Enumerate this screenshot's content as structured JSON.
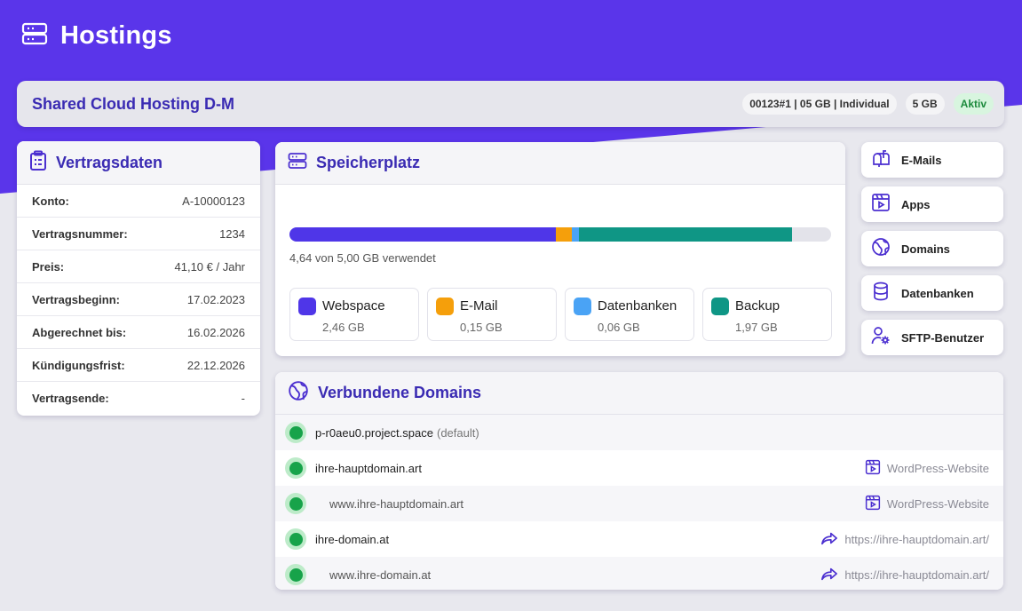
{
  "header": {
    "title": "Hostings",
    "icon": "server-icon"
  },
  "product": {
    "title": "Shared Cloud Hosting D-M",
    "badges": [
      "00123#1 | 05 GB | Individual",
      "5 GB"
    ],
    "status": "Aktiv"
  },
  "contract": {
    "title": "Vertragsdaten",
    "rows": [
      {
        "label": "Konto:",
        "value": "A-10000123"
      },
      {
        "label": "Vertragsnummer:",
        "value": "1234"
      },
      {
        "label": "Preis:",
        "value": "41,10 € / Jahr"
      },
      {
        "label": "Vertragsbeginn:",
        "value": "17.02.2023"
      },
      {
        "label": "Abgerechnet bis:",
        "value": "16.02.2026"
      },
      {
        "label": "Kündigungsfrist:",
        "value": "22.12.2026"
      },
      {
        "label": "Vertragsende:",
        "value": "-"
      }
    ]
  },
  "storage": {
    "title": "Speicherplatz",
    "used_text": "4,64 von 5,00 GB verwendet",
    "total_gb": 5.0,
    "segments": [
      {
        "name": "Webspace",
        "value": "2,46 GB",
        "gb": 2.46,
        "color": "#4f36e8"
      },
      {
        "name": "E-Mail",
        "value": "0,15 GB",
        "gb": 0.15,
        "color": "#f59f0b"
      },
      {
        "name": "Datenbanken",
        "value": "0,06 GB",
        "gb": 0.06,
        "color": "#4aa3f5"
      },
      {
        "name": "Backup",
        "value": "1,97 GB",
        "gb": 1.97,
        "color": "#0f9685"
      }
    ]
  },
  "quick_links": [
    {
      "label": "E-Mails",
      "icon": "mailbox-icon"
    },
    {
      "label": "Apps",
      "icon": "app-icon"
    },
    {
      "label": "Domains",
      "icon": "globe-icon"
    },
    {
      "label": "Datenbanken",
      "icon": "database-icon"
    },
    {
      "label": "SFTP-Benutzer",
      "icon": "user-gear-icon"
    }
  ],
  "domains": {
    "title": "Verbundene Domains",
    "items": [
      {
        "name": "p-r0aeu0.project.space",
        "flag": "(default)",
        "target": "",
        "target_icon": ""
      },
      {
        "name": "ihre-hauptdomain.art",
        "flag": "",
        "target": "WordPress-Website",
        "target_icon": "app-icon"
      },
      {
        "name": "www.ihre-hauptdomain.art",
        "flag": "",
        "target": "WordPress-Website",
        "target_icon": "app-icon"
      },
      {
        "name": "ihre-domain.at",
        "flag": "",
        "target": "https://ihre-hauptdomain.art/",
        "target_icon": "redirect-icon"
      },
      {
        "name": "www.ihre-domain.at",
        "flag": "",
        "target": "https://ihre-hauptdomain.art/",
        "target_icon": "redirect-icon"
      }
    ]
  }
}
